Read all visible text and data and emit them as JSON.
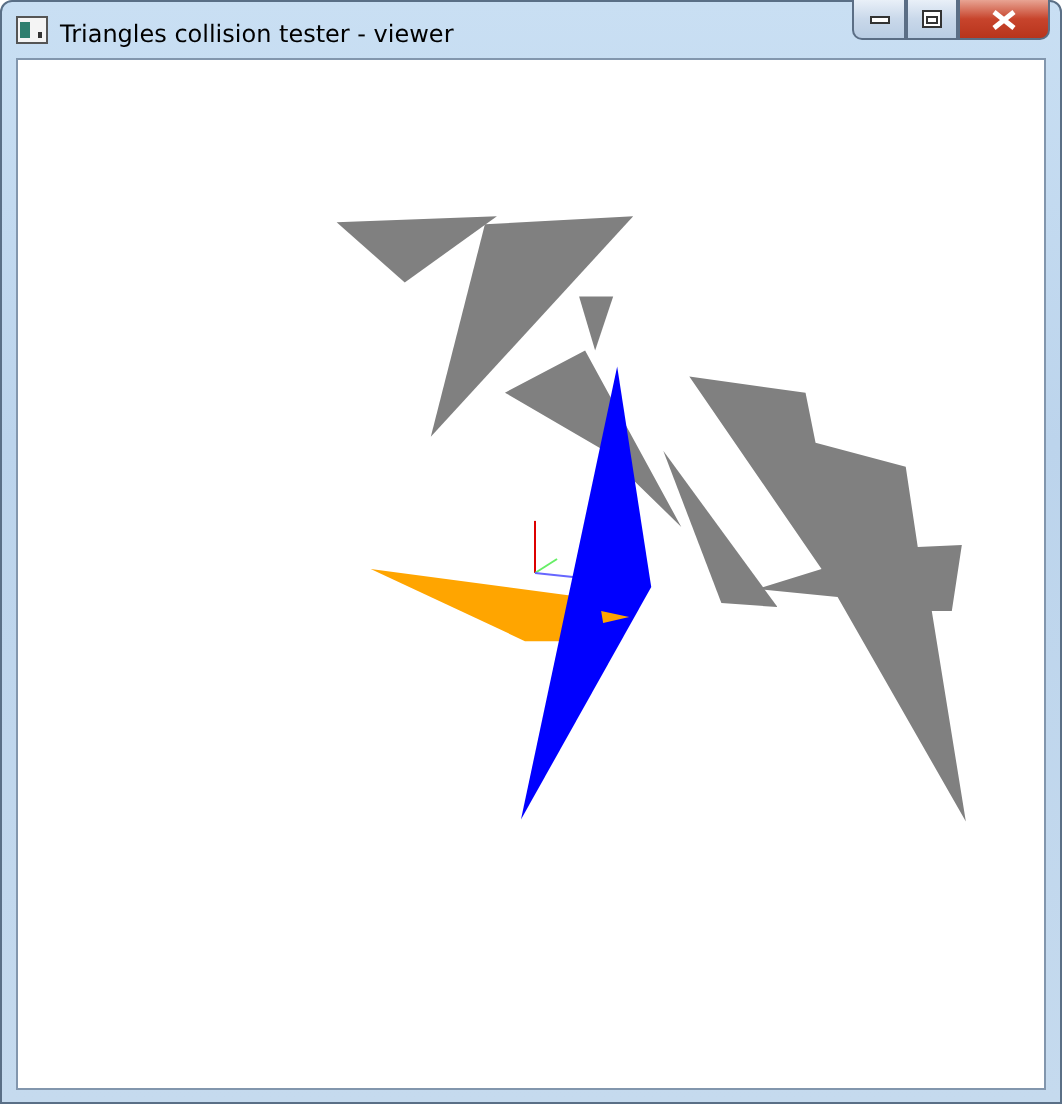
{
  "window": {
    "title": "Triangles collision tester - viewer"
  }
}
